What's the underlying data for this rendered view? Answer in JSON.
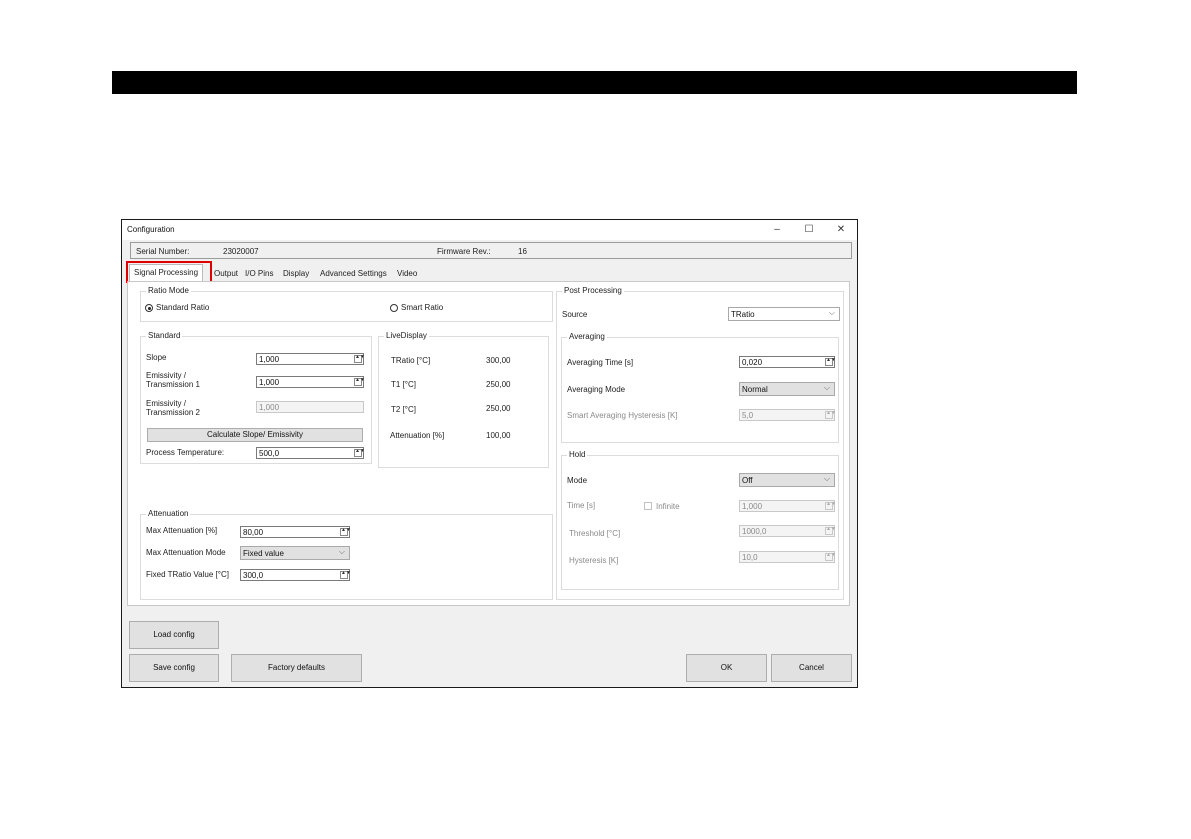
{
  "window": {
    "title": "Configuration",
    "minimize_icon": "minimize-icon",
    "maximize_icon": "maximize-icon",
    "close_icon": "close-icon"
  },
  "info": {
    "serial_label": "Serial Number:",
    "serial_value": "23020007",
    "firmware_label": "Firmware Rev.:",
    "firmware_value": "16"
  },
  "tabs": [
    "Signal Processing",
    "Output",
    "I/O Pins",
    "Display",
    "Advanced Settings",
    "Video"
  ],
  "ratio_mode": {
    "title": "Ratio Mode",
    "standard": "Standard Ratio",
    "smart": "Smart Ratio",
    "selected": "Standard Ratio"
  },
  "standard": {
    "title": "Standard",
    "slope_label": "Slope",
    "slope_value": "1,000",
    "emis1_label1": "Emissivity /",
    "emis1_label2": "Transmission 1",
    "emis1_value": "1,000",
    "emis2_label1": "Emissivity /",
    "emis2_label2": "Transmission 2",
    "emis2_value": "1,000",
    "calc_button": "Calculate Slope/ Emissivity",
    "proc_temp_label": "Process Temperature:",
    "proc_temp_value": "500,0"
  },
  "live": {
    "title": "LiveDisplay",
    "rows": [
      {
        "label": "TRatio [°C]",
        "value": "300,00"
      },
      {
        "label": "T1 [°C]",
        "value": "250,00"
      },
      {
        "label": "T2 [°C]",
        "value": "250,00"
      },
      {
        "label": "Attenuation [%]",
        "value": "100,00"
      }
    ]
  },
  "attenuation": {
    "title": "Attenuation",
    "max_label": "Max Attenuation [%]",
    "max_value": "80,00",
    "mode_label": "Max Attenuation Mode",
    "mode_value": "Fixed value",
    "fixed_label": "Fixed TRatio Value [°C]",
    "fixed_value": "300,0"
  },
  "post": {
    "title": "Post Processing",
    "source_label": "Source",
    "source_value": "TRatio",
    "averaging": {
      "title": "Averaging",
      "time_label": "Averaging Time [s]",
      "time_value": "0,020",
      "mode_label": "Averaging Mode",
      "mode_value": "Normal",
      "hyst_label": "Smart Averaging Hysteresis [K]",
      "hyst_value": "5,0"
    },
    "hold": {
      "title": "Hold",
      "mode_label": "Mode",
      "mode_value": "Off",
      "time_label": "Time [s]",
      "infinite_label": "Infinite",
      "time_value": "1,000",
      "threshold_label": "Threshold [°C]",
      "threshold_value": "1000,0",
      "hyst_label": "Hysteresis [K]",
      "hyst_value": "10,0"
    }
  },
  "buttons": {
    "load": "Load config",
    "save": "Save config",
    "factory": "Factory defaults",
    "ok": "OK",
    "cancel": "Cancel"
  }
}
